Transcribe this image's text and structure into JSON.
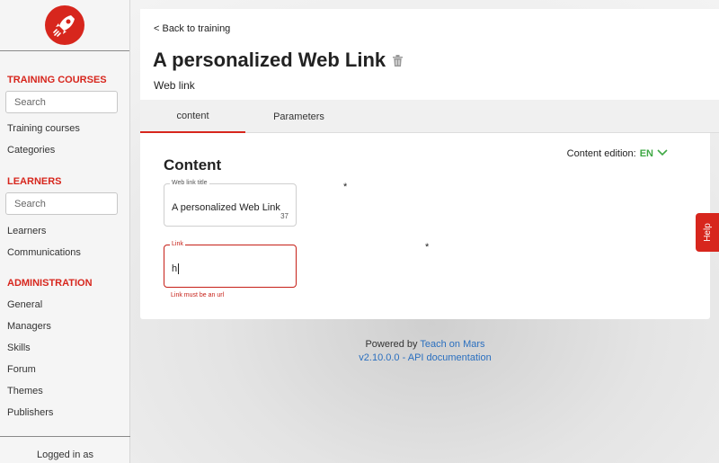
{
  "sidebar": {
    "logo_icon": "rocket-icon",
    "sections": {
      "training": {
        "title": "TRAINING COURSES",
        "search_placeholder": "Search",
        "items": [
          "Training courses",
          "Categories"
        ]
      },
      "learners": {
        "title": "LEARNERS",
        "search_placeholder": "Search",
        "items": [
          "Learners",
          "Communications"
        ]
      },
      "administration": {
        "title": "ADMINISTRATION",
        "items": [
          "General",
          "Managers",
          "Skills",
          "Forum",
          "Themes",
          "Publishers"
        ]
      }
    },
    "logged_in": "Logged in as"
  },
  "header": {
    "back_link": "< Back to training",
    "title": "A personalized Web Link",
    "subtitle": "Web link"
  },
  "tabs": [
    "content",
    "Parameters"
  ],
  "content": {
    "title": "Content",
    "edition_label": "Content edition:",
    "edition_lang": "EN",
    "fields": {
      "title_field": {
        "label": "Web link title",
        "value": "A personalized Web Link",
        "count": "37",
        "required_mark": "*"
      },
      "link_field": {
        "label": "Link",
        "value": "h",
        "error": "Link must be an url",
        "required_mark": "*"
      }
    }
  },
  "footer": {
    "powered_by": "Powered by",
    "brand": "Teach on Mars",
    "version": "v2.10.0.0",
    "separator": " - ",
    "api_doc": "API documentation"
  },
  "help": "Help",
  "colors": {
    "accent": "#d7261d",
    "link": "#2a6fbf",
    "lang": "#3fa845",
    "error": "#c61f17"
  }
}
